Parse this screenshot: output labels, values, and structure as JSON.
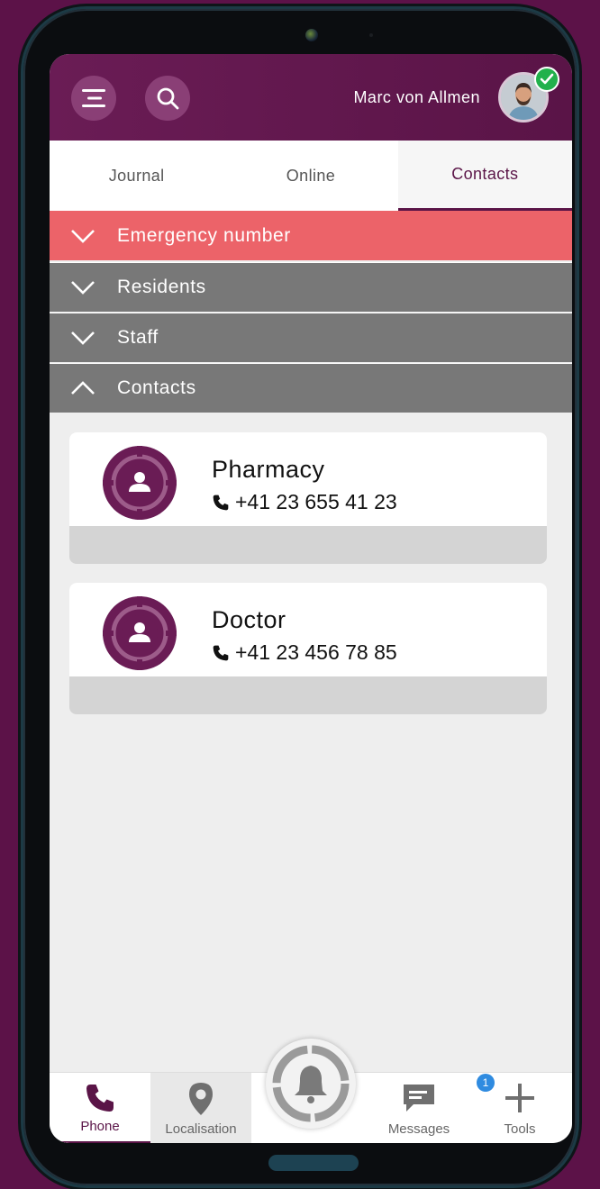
{
  "header": {
    "menu_icon": "menu-icon",
    "search_icon": "search-icon",
    "user_name": "Marc von Allmen",
    "status": "online"
  },
  "tabs": [
    {
      "label": "Journal",
      "active": false
    },
    {
      "label": "Online",
      "active": false
    },
    {
      "label": "Contacts",
      "active": true
    }
  ],
  "sections": [
    {
      "label": "Emergency number",
      "expanded": false,
      "color": "#ec6369"
    },
    {
      "label": "Residents",
      "expanded": false,
      "color": "#787878"
    },
    {
      "label": "Staff",
      "expanded": false,
      "color": "#787878"
    },
    {
      "label": "Contacts",
      "expanded": true,
      "color": "#787878"
    }
  ],
  "contacts": [
    {
      "name": "Pharmacy",
      "phone": "+41 23 655 41 23"
    },
    {
      "name": "Doctor",
      "phone": "+41 23 456 78 85"
    }
  ],
  "bottom_nav": {
    "phone": "Phone",
    "localisation": "Localisation",
    "messages": "Messages",
    "messages_badge": "1",
    "tools": "Tools",
    "active": "Phone"
  },
  "colors": {
    "brand": "#5a1447",
    "emergency": "#ec6369",
    "section": "#787878",
    "online": "#22b14c",
    "badge": "#2f8be0"
  }
}
